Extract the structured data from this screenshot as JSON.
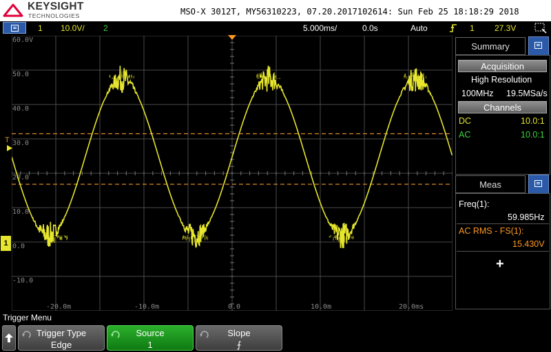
{
  "header": {
    "brand": "KEYSIGHT",
    "brand_sub": "TECHNOLOGIES",
    "device_info": "MSO-X 3012T, MY56310223, 07.20.2017102614: Sun Feb 25 18:18:29 2018"
  },
  "status_bar": {
    "ch1_label": "1",
    "ch1_scale": "10.0V/",
    "ch2_label": "2",
    "timebase": "5.000ms/",
    "delay": "0.0s",
    "trigger_mode": "Auto",
    "trigger_source": "1",
    "trigger_level": "27.3V"
  },
  "scope": {
    "y_ticks": [
      "60.0V",
      "50.0",
      "40.0",
      "30.0",
      "20.0",
      "10.0",
      "0.0",
      "-10.0"
    ],
    "x_ticks": [
      "-20.0m",
      "-10.0m",
      "0.0",
      "10.0m",
      "20.0ms"
    ],
    "trigger_marker": "T",
    "ground_marker": "1",
    "colors": {
      "ch1": "#e6e62e",
      "cursor": "#d98a2a",
      "grid": "#4a4a4a"
    }
  },
  "summary_panel": {
    "title": "Summary",
    "acquisition_label": "Acquisition",
    "acq_mode": "High Resolution",
    "bandwidth": "100MHz",
    "sample_rate": "19.5MSa/s",
    "channels_label": "Channels",
    "channels": [
      {
        "coupling": "DC",
        "probe": "10.0:1",
        "color": "#e6e62e"
      },
      {
        "coupling": "AC",
        "probe": "10.0:1",
        "color": "#3fd43f"
      }
    ]
  },
  "meas_panel": {
    "title": "Meas",
    "measurements": [
      {
        "name": "Freq(1):",
        "value": "59.985Hz",
        "color": "#ffffff"
      },
      {
        "name": "AC RMS - FS(1):",
        "value": "15.430V",
        "color": "#ff9a1f"
      }
    ],
    "add_symbol": "+"
  },
  "softkeys": {
    "menu_title": "Trigger Menu",
    "items": [
      {
        "label": "Trigger Type",
        "value": "Edge"
      },
      {
        "label": "Source",
        "value": "1"
      },
      {
        "label": "Slope",
        "value": "⨍"
      }
    ]
  },
  "chart_data": {
    "type": "line",
    "series": [
      {
        "name": "1",
        "x_ms": [
          -20,
          -12.5,
          -4.2,
          4.1,
          12.4,
          20.7
        ],
        "y_v": [
          2,
          47.5,
          2,
          47.5,
          2,
          47.5
        ]
      }
    ],
    "y_ticks": [
      "60.0V",
      "50.0",
      "40.0",
      "30.0",
      "20.0",
      "10.0",
      "0.0",
      "-10.0"
    ],
    "x_ticks": [
      "-20.0m",
      "-10.0m",
      "0.0",
      "10.0m",
      "20.0ms"
    ],
    "xlim_ms": [
      -25,
      25
    ],
    "ylim_v": [
      -20,
      60
    ],
    "frequency_hz": 59.985,
    "cursors_v": [
      31.5,
      16.8
    ],
    "grid": true
  }
}
